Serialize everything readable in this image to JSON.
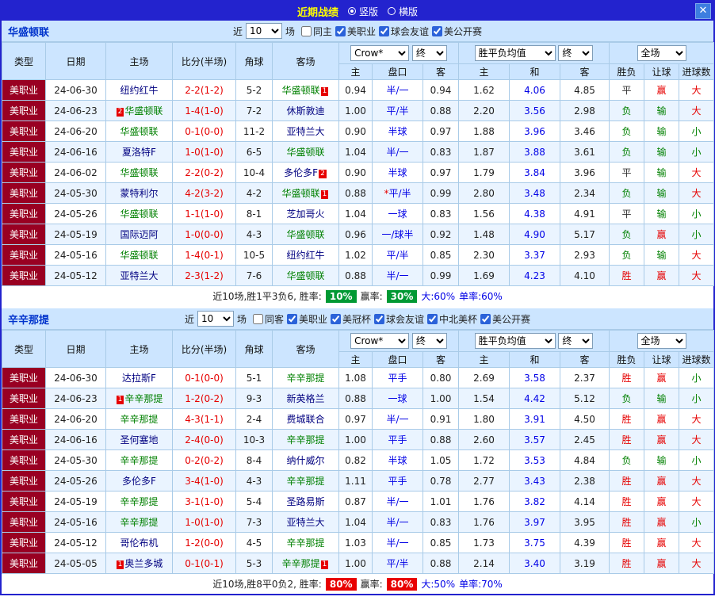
{
  "topbar": {
    "title": "近期战绩",
    "vertical_label": "竖版",
    "horizontal_label": "横版",
    "close_label": "✕"
  },
  "colors": {
    "topbar_bg": "#2323CE",
    "title_text": "#FFFF00",
    "panel_header_bg": "#CCE5FF",
    "grid_border": "#A9CBE8",
    "alt_row_bg": "#EAF4FF",
    "type_cell_bg": "#990022",
    "focus_team": "#008000",
    "opponent_team": "#000080",
    "score_text": "#E60000",
    "handicap_text": "#0000E6",
    "draw_odds_text": "#0000E6",
    "badge_bg": "#E60000",
    "team_title_text": "#0033CC"
  },
  "value_colors": {
    "胜": "#E60000",
    "平": "#333333",
    "负": "#008000",
    "赢": "#E60000",
    "输": "#008000",
    "大": "#E60000",
    "小": "#008000"
  },
  "table_header": {
    "type": "类型",
    "date": "日期",
    "home": "主场",
    "score": "比分(半场)",
    "corner": "角球",
    "away": "客场",
    "asia_company_select": "Crow*",
    "asia_final_select": "终",
    "europe_select": "胜平负均值",
    "europe_final_select": "终",
    "fullmatch_select": "全场",
    "asia_home": "主",
    "asia_handicap": "盘口",
    "asia_away": "客",
    "europe_home": "主",
    "europe_draw": "和",
    "europe_away": "客",
    "result": "胜负",
    "handicap_result": "让球",
    "goals": "进球数"
  },
  "sections": [
    {
      "team": "华盛顿联",
      "filters": {
        "near_label": "近",
        "count": "10",
        "games_label": "场",
        "checkboxes": [
          {
            "label": "同主",
            "checked": false
          },
          {
            "label": "美职业",
            "checked": true
          },
          {
            "label": "球会友谊",
            "checked": true
          },
          {
            "label": "美公开赛",
            "checked": true
          }
        ]
      },
      "rows": [
        {
          "type": "美职业",
          "date": "24-06-30",
          "home": {
            "pre": "",
            "name": "纽约红牛",
            "post": ""
          },
          "score": "2-2(1-2)",
          "corner": "5-2",
          "away": {
            "pre": "",
            "name": "华盛顿联",
            "post": "1"
          },
          "asia_home": "0.94",
          "handicap": "半/一",
          "asia_away": "0.94",
          "eu_home": "1.62",
          "eu_draw": "4.06",
          "eu_away": "4.85",
          "result": "平",
          "let_result": "赢",
          "goal_result": "大"
        },
        {
          "type": "美职业",
          "date": "24-06-23",
          "home": {
            "pre": "2",
            "name": "华盛顿联",
            "post": ""
          },
          "score": "1-4(1-0)",
          "corner": "7-2",
          "away": {
            "pre": "",
            "name": "休斯敦迪",
            "post": ""
          },
          "asia_home": "1.00",
          "handicap": "平/半",
          "asia_away": "0.88",
          "eu_home": "2.20",
          "eu_draw": "3.56",
          "eu_away": "2.98",
          "result": "负",
          "let_result": "输",
          "goal_result": "大"
        },
        {
          "type": "美职业",
          "date": "24-06-20",
          "home": {
            "pre": "",
            "name": "华盛顿联",
            "post": ""
          },
          "score": "0-1(0-0)",
          "corner": "11-2",
          "away": {
            "pre": "",
            "name": "亚特兰大",
            "post": ""
          },
          "asia_home": "0.90",
          "handicap": "半球",
          "asia_away": "0.97",
          "eu_home": "1.88",
          "eu_draw": "3.96",
          "eu_away": "3.46",
          "result": "负",
          "let_result": "输",
          "goal_result": "小"
        },
        {
          "type": "美职业",
          "date": "24-06-16",
          "home": {
            "pre": "",
            "name": "夏洛特F",
            "post": ""
          },
          "score": "1-0(1-0)",
          "corner": "6-5",
          "away": {
            "pre": "",
            "name": "华盛顿联",
            "post": ""
          },
          "asia_home": "1.04",
          "handicap": "半/一",
          "asia_away": "0.83",
          "eu_home": "1.87",
          "eu_draw": "3.88",
          "eu_away": "3.61",
          "result": "负",
          "let_result": "输",
          "goal_result": "小"
        },
        {
          "type": "美职业",
          "date": "24-06-02",
          "home": {
            "pre": "",
            "name": "华盛顿联",
            "post": ""
          },
          "score": "2-2(0-2)",
          "corner": "10-4",
          "away": {
            "pre": "",
            "name": "多伦多F",
            "post": "2"
          },
          "asia_home": "0.90",
          "handicap": "半球",
          "asia_away": "0.97",
          "eu_home": "1.79",
          "eu_draw": "3.84",
          "eu_away": "3.96",
          "result": "平",
          "let_result": "输",
          "goal_result": "大"
        },
        {
          "type": "美职业",
          "date": "24-05-30",
          "home": {
            "pre": "",
            "name": "蒙特利尔",
            "post": ""
          },
          "score": "4-2(3-2)",
          "corner": "4-2",
          "away": {
            "pre": "",
            "name": "华盛顿联",
            "post": "1"
          },
          "asia_home": "0.88",
          "handicap": "*平/半",
          "asia_away": "0.99",
          "eu_home": "2.80",
          "eu_draw": "3.48",
          "eu_away": "2.34",
          "result": "负",
          "let_result": "输",
          "goal_result": "大"
        },
        {
          "type": "美职业",
          "date": "24-05-26",
          "home": {
            "pre": "",
            "name": "华盛顿联",
            "post": ""
          },
          "score": "1-1(1-0)",
          "corner": "8-1",
          "away": {
            "pre": "",
            "name": "芝加哥火",
            "post": ""
          },
          "asia_home": "1.04",
          "handicap": "一球",
          "asia_away": "0.83",
          "eu_home": "1.56",
          "eu_draw": "4.38",
          "eu_away": "4.91",
          "result": "平",
          "let_result": "输",
          "goal_result": "小"
        },
        {
          "type": "美职业",
          "date": "24-05-19",
          "home": {
            "pre": "",
            "name": "国际迈阿",
            "post": ""
          },
          "score": "1-0(0-0)",
          "corner": "4-3",
          "away": {
            "pre": "",
            "name": "华盛顿联",
            "post": ""
          },
          "asia_home": "0.96",
          "handicap": "一/球半",
          "asia_away": "0.92",
          "eu_home": "1.48",
          "eu_draw": "4.90",
          "eu_away": "5.17",
          "result": "负",
          "let_result": "赢",
          "goal_result": "小"
        },
        {
          "type": "美职业",
          "date": "24-05-16",
          "home": {
            "pre": "",
            "name": "华盛顿联",
            "post": ""
          },
          "score": "1-4(0-1)",
          "corner": "10-5",
          "away": {
            "pre": "",
            "name": "纽约红牛",
            "post": ""
          },
          "asia_home": "1.02",
          "handicap": "平/半",
          "asia_away": "0.85",
          "eu_home": "2.30",
          "eu_draw": "3.37",
          "eu_away": "2.93",
          "result": "负",
          "let_result": "输",
          "goal_result": "大"
        },
        {
          "type": "美职业",
          "date": "24-05-12",
          "home": {
            "pre": "",
            "name": "亚特兰大",
            "post": ""
          },
          "score": "2-3(1-2)",
          "corner": "7-6",
          "away": {
            "pre": "",
            "name": "华盛顿联",
            "post": ""
          },
          "asia_home": "0.88",
          "handicap": "半/一",
          "asia_away": "0.99",
          "eu_home": "1.69",
          "eu_draw": "4.23",
          "eu_away": "4.10",
          "result": "胜",
          "let_result": "赢",
          "goal_result": "大"
        }
      ],
      "summary": {
        "prefix": "近10场,胜1平3负6, 胜率:",
        "win_value": "10%",
        "profit_label": "赢率:",
        "profit_value": "30%",
        "big": "大:60%",
        "single": "单率:60%",
        "box_color": "#009933"
      }
    },
    {
      "team": "辛辛那提",
      "filters": {
        "near_label": "近",
        "count": "10",
        "games_label": "场",
        "checkboxes": [
          {
            "label": "同客",
            "checked": false
          },
          {
            "label": "美职业",
            "checked": true
          },
          {
            "label": "美冠杯",
            "checked": true
          },
          {
            "label": "球会友谊",
            "checked": true
          },
          {
            "label": "中北美杯",
            "checked": true
          },
          {
            "label": "美公开赛",
            "checked": true
          }
        ]
      },
      "rows": [
        {
          "type": "美职业",
          "date": "24-06-30",
          "home": {
            "pre": "",
            "name": "达拉斯F",
            "post": ""
          },
          "score": "0-1(0-0)",
          "corner": "5-1",
          "away": {
            "pre": "",
            "name": "辛辛那提",
            "post": ""
          },
          "asia_home": "1.08",
          "handicap": "平手",
          "asia_away": "0.80",
          "eu_home": "2.69",
          "eu_draw": "3.58",
          "eu_away": "2.37",
          "result": "胜",
          "let_result": "赢",
          "goal_result": "小"
        },
        {
          "type": "美职业",
          "date": "24-06-23",
          "home": {
            "pre": "1",
            "name": "辛辛那提",
            "post": ""
          },
          "score": "1-2(0-2)",
          "corner": "9-3",
          "away": {
            "pre": "",
            "name": "新英格兰",
            "post": ""
          },
          "asia_home": "0.88",
          "handicap": "一球",
          "asia_away": "1.00",
          "eu_home": "1.54",
          "eu_draw": "4.42",
          "eu_away": "5.12",
          "result": "负",
          "let_result": "输",
          "goal_result": "小"
        },
        {
          "type": "美职业",
          "date": "24-06-20",
          "home": {
            "pre": "",
            "name": "辛辛那提",
            "post": ""
          },
          "score": "4-3(1-1)",
          "corner": "2-4",
          "away": {
            "pre": "",
            "name": "费城联合",
            "post": ""
          },
          "asia_home": "0.97",
          "handicap": "半/一",
          "asia_away": "0.91",
          "eu_home": "1.80",
          "eu_draw": "3.91",
          "eu_away": "4.50",
          "result": "胜",
          "let_result": "赢",
          "goal_result": "大"
        },
        {
          "type": "美职业",
          "date": "24-06-16",
          "home": {
            "pre": "",
            "name": "圣何塞地",
            "post": ""
          },
          "score": "2-4(0-0)",
          "corner": "10-3",
          "away": {
            "pre": "",
            "name": "辛辛那提",
            "post": ""
          },
          "asia_home": "1.00",
          "handicap": "平手",
          "asia_away": "0.88",
          "eu_home": "2.60",
          "eu_draw": "3.57",
          "eu_away": "2.45",
          "result": "胜",
          "let_result": "赢",
          "goal_result": "大"
        },
        {
          "type": "美职业",
          "date": "24-05-30",
          "home": {
            "pre": "",
            "name": "辛辛那提",
            "post": ""
          },
          "score": "0-2(0-2)",
          "corner": "8-4",
          "away": {
            "pre": "",
            "name": "纳什威尔",
            "post": ""
          },
          "asia_home": "0.82",
          "handicap": "半球",
          "asia_away": "1.05",
          "eu_home": "1.72",
          "eu_draw": "3.53",
          "eu_away": "4.84",
          "result": "负",
          "let_result": "输",
          "goal_result": "小"
        },
        {
          "type": "美职业",
          "date": "24-05-26",
          "home": {
            "pre": "",
            "name": "多伦多F",
            "post": ""
          },
          "score": "3-4(1-0)",
          "corner": "4-3",
          "away": {
            "pre": "",
            "name": "辛辛那提",
            "post": ""
          },
          "asia_home": "1.11",
          "handicap": "平手",
          "asia_away": "0.78",
          "eu_home": "2.77",
          "eu_draw": "3.43",
          "eu_away": "2.38",
          "result": "胜",
          "let_result": "赢",
          "goal_result": "大"
        },
        {
          "type": "美职业",
          "date": "24-05-19",
          "home": {
            "pre": "",
            "name": "辛辛那提",
            "post": ""
          },
          "score": "3-1(1-0)",
          "corner": "5-4",
          "away": {
            "pre": "",
            "name": "圣路易斯",
            "post": ""
          },
          "asia_home": "0.87",
          "handicap": "半/一",
          "asia_away": "1.01",
          "eu_home": "1.76",
          "eu_draw": "3.82",
          "eu_away": "4.14",
          "result": "胜",
          "let_result": "赢",
          "goal_result": "大"
        },
        {
          "type": "美职业",
          "date": "24-05-16",
          "home": {
            "pre": "",
            "name": "辛辛那提",
            "post": ""
          },
          "score": "1-0(1-0)",
          "corner": "7-3",
          "away": {
            "pre": "",
            "name": "亚特兰大",
            "post": ""
          },
          "asia_home": "1.04",
          "handicap": "半/一",
          "asia_away": "0.83",
          "eu_home": "1.76",
          "eu_draw": "3.97",
          "eu_away": "3.95",
          "result": "胜",
          "let_result": "赢",
          "goal_result": "小"
        },
        {
          "type": "美职业",
          "date": "24-05-12",
          "home": {
            "pre": "",
            "name": "哥伦布机",
            "post": ""
          },
          "score": "1-2(0-0)",
          "corner": "4-5",
          "away": {
            "pre": "",
            "name": "辛辛那提",
            "post": ""
          },
          "asia_home": "1.03",
          "handicap": "半/一",
          "asia_away": "0.85",
          "eu_home": "1.73",
          "eu_draw": "3.75",
          "eu_away": "4.39",
          "result": "胜",
          "let_result": "赢",
          "goal_result": "大"
        },
        {
          "type": "美职业",
          "date": "24-05-05",
          "home": {
            "pre": "1",
            "name": "奥兰多城",
            "post": ""
          },
          "score": "0-1(0-1)",
          "corner": "5-3",
          "away": {
            "pre": "",
            "name": "辛辛那提",
            "post": "1"
          },
          "asia_home": "1.00",
          "handicap": "平/半",
          "asia_away": "0.88",
          "eu_home": "2.14",
          "eu_draw": "3.40",
          "eu_away": "3.19",
          "result": "胜",
          "let_result": "赢",
          "goal_result": "大"
        }
      ],
      "summary": {
        "prefix": "近10场,胜8平0负2, 胜率:",
        "win_value": "80%",
        "profit_label": "赢率:",
        "profit_value": "80%",
        "big": "大:50%",
        "single": "单率:70%",
        "box_color": "#E80000"
      }
    }
  ]
}
